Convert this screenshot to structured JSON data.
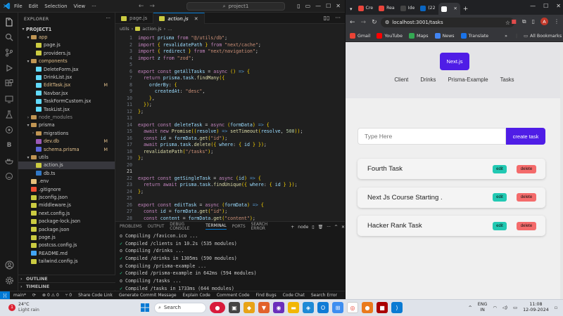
{
  "vscode": {
    "menu": [
      "File",
      "Edit",
      "Selection",
      "View"
    ],
    "search": "project1",
    "explorer_header": "EXPLORER",
    "tree": [
      {
        "label": "PROJECT1",
        "depth": 0,
        "arrow": "▾",
        "kind": "root",
        "status": "",
        "color": "#cccccc"
      },
      {
        "label": "app",
        "depth": 1,
        "arrow": "▾",
        "kind": "folder",
        "status": "",
        "color": "#e2c08d"
      },
      {
        "label": "page.js",
        "depth": 2,
        "arrow": "",
        "kind": "js",
        "status": "",
        "color": "#cccccc"
      },
      {
        "label": "providers.js",
        "depth": 2,
        "arrow": "",
        "kind": "js",
        "status": "",
        "color": "#cccccc"
      },
      {
        "label": "components",
        "depth": 1,
        "arrow": "▾",
        "kind": "folder",
        "status": "",
        "color": "#e2c08d"
      },
      {
        "label": "DeleteForm.jsx",
        "depth": 2,
        "arrow": "",
        "kind": "jsx",
        "status": "",
        "color": "#cccccc"
      },
      {
        "label": "DrinkList.jsx",
        "depth": 2,
        "arrow": "",
        "kind": "jsx",
        "status": "",
        "color": "#cccccc"
      },
      {
        "label": "EditTask.jsx",
        "depth": 2,
        "arrow": "",
        "kind": "jsx",
        "status": "M",
        "color": "#e2c08d"
      },
      {
        "label": "Navbar.jsx",
        "depth": 2,
        "arrow": "",
        "kind": "jsx",
        "status": "",
        "color": "#cccccc"
      },
      {
        "label": "TaskFormCustom.jsx",
        "depth": 2,
        "arrow": "",
        "kind": "jsx",
        "status": "",
        "color": "#cccccc"
      },
      {
        "label": "TaskList.jsx",
        "depth": 2,
        "arrow": "",
        "kind": "jsx",
        "status": "",
        "color": "#cccccc"
      },
      {
        "label": "node_modules",
        "depth": 1,
        "arrow": "›",
        "kind": "folder",
        "status": "",
        "color": "#8c8c8c"
      },
      {
        "label": "prisma",
        "depth": 1,
        "arrow": "▾",
        "kind": "folder",
        "status": "",
        "color": "#cccccc"
      },
      {
        "label": "migrations",
        "depth": 2,
        "arrow": "›",
        "kind": "folder",
        "status": "",
        "color": "#cccccc"
      },
      {
        "label": "dev.db",
        "depth": 2,
        "arrow": "",
        "kind": "db",
        "status": "M",
        "color": "#e2c08d"
      },
      {
        "label": "schema.prisma",
        "depth": 2,
        "arrow": "",
        "kind": "prisma",
        "status": "M",
        "color": "#e2c08d"
      },
      {
        "label": "utils",
        "depth": 1,
        "arrow": "▾",
        "kind": "folder",
        "status": "",
        "color": "#cccccc"
      },
      {
        "label": "action.js",
        "depth": 2,
        "arrow": "",
        "kind": "js",
        "status": "",
        "color": "#cccccc",
        "selected": true
      },
      {
        "label": "db.ts",
        "depth": 2,
        "arrow": "",
        "kind": "ts",
        "status": "",
        "color": "#cccccc"
      },
      {
        "label": ".env",
        "depth": 1,
        "arrow": "",
        "kind": "env",
        "status": "",
        "color": "#cccccc"
      },
      {
        "label": ".gitignore",
        "depth": 1,
        "arrow": "",
        "kind": "git",
        "status": "",
        "color": "#cccccc"
      },
      {
        "label": "jsconfig.json",
        "depth": 1,
        "arrow": "",
        "kind": "json",
        "status": "",
        "color": "#cccccc"
      },
      {
        "label": "middleware.js",
        "depth": 1,
        "arrow": "",
        "kind": "js",
        "status": "",
        "color": "#cccccc"
      },
      {
        "label": "next.config.js",
        "depth": 1,
        "arrow": "",
        "kind": "js",
        "status": "",
        "color": "#cccccc"
      },
      {
        "label": "package-lock.json",
        "depth": 1,
        "arrow": "",
        "kind": "json",
        "status": "",
        "color": "#cccccc"
      },
      {
        "label": "package.json",
        "depth": 1,
        "arrow": "",
        "kind": "json",
        "status": "",
        "color": "#cccccc"
      },
      {
        "label": "page.js",
        "depth": 1,
        "arrow": "",
        "kind": "js",
        "status": "",
        "color": "#cccccc"
      },
      {
        "label": "postcss.config.js",
        "depth": 1,
        "arrow": "",
        "kind": "js",
        "status": "",
        "color": "#cccccc"
      },
      {
        "label": "README.md",
        "depth": 1,
        "arrow": "",
        "kind": "md",
        "status": "",
        "color": "#cccccc"
      },
      {
        "label": "tailwind.config.js",
        "depth": 1,
        "arrow": "",
        "kind": "js",
        "status": "",
        "color": "#cccccc"
      }
    ],
    "outline": "OUTLINE",
    "timeline": "TIMELINE",
    "tabs": [
      {
        "label": "page.js",
        "active": false
      },
      {
        "label": "action.js",
        "active": true
      }
    ],
    "breadcrumb": [
      "utils",
      "›",
      "action.js",
      "›",
      "..."
    ],
    "current_line": 21,
    "code_lines": [
      "import prisma from \"@/utils/db\";",
      "import { revalidatePath } from \"next/cache\";",
      "import { redirect } from \"next/navigation\";",
      "import z from \"zod\";",
      "",
      "export const getAllTasks = async () => {",
      "  return prisma.task.findMany({",
      "    orderBy: {",
      "      createdAt: \"desc\",",
      "    },",
      "  });",
      "};",
      "",
      "export const deleteTask = async (formData) => {",
      "  await new Promise((resolve) => setTimeout(resolve, 500));",
      "  const id = formData.get(\"id\");",
      "  await prisma.task.delete({ where: { id } });",
      "  revalidatePath(\"/tasks\");",
      "};",
      "",
      "",
      "export const getSingleTask = async (id) => {",
      "  return await prisma.task.findUnique({ where: { id } });",
      "};",
      "",
      "export const editTask = async (formData) => {",
      "  const id = formData.get(\"id\");",
      "  const content = formData.get(\"content\");"
    ],
    "panel_tabs": [
      "PROBLEMS",
      "OUTPUT",
      "DEBUG CONSOLE",
      "TERMINAL",
      "PORTS",
      "SEARCH ERROR"
    ],
    "panel_active": "TERMINAL",
    "terminal_shell": "node",
    "terminal_lines": [
      {
        "mark": "o",
        "text": "Compiling /favicon.ico ..."
      },
      {
        "mark": "✓",
        "text": "Compiled /clients in 10.2s (535 modules)"
      },
      {
        "mark": "o",
        "text": "Compiling /drinks ..."
      },
      {
        "mark": "✓",
        "text": "Compiled /drinks in 1305ms (590 modules)"
      },
      {
        "mark": "o",
        "text": "Compiling /prisma-example ..."
      },
      {
        "mark": "✓",
        "text": "Compiled /prisma-example in 642ms (594 modules)"
      },
      {
        "mark": "o",
        "text": "Compiling /tasks ..."
      },
      {
        "mark": "✓",
        "text": "Compiled /tasks in 1733ms (644 modules)"
      },
      {
        "mark": "",
        "text": "▯"
      }
    ],
    "status_items": [
      "main*",
      "⟳",
      "⊗ 0 ⚠ 0",
      "⑂ 0",
      "Share Code Link",
      "Generate Commit Message",
      "Explain Code",
      "Comment Code",
      "Find Bugs",
      "Code Chat",
      "Search Error"
    ]
  },
  "chrome": {
    "tabs": [
      {
        "label": "Cre",
        "color": "#e8453c"
      },
      {
        "label": "Rea",
        "color": "#e8453c"
      },
      {
        "label": "Ide",
        "color": "#444444"
      },
      {
        "label": "(22",
        "color": "#0a66c2"
      },
      {
        "label": "",
        "color": "#ffffff",
        "active": true
      }
    ],
    "url": "localhost:3001/tasks",
    "bookmarks": [
      "Gmail",
      "YouTube",
      "Maps",
      "News",
      "Translate"
    ],
    "all_bookmarks": "All Bookmarks",
    "avatar": "A"
  },
  "app": {
    "brand": "Next.js",
    "nav": [
      "Client",
      "Drinks",
      "Prisma-Example",
      "Tasks"
    ],
    "input_placeholder": "Type Here",
    "create_label": "create task",
    "tasks": [
      {
        "title": "Fourth Task",
        "edit": "edit",
        "delete": "delete"
      },
      {
        "title": "Next Js Course Starting .",
        "edit": "edit",
        "delete": "delete"
      },
      {
        "title": "Hacker Rank Task",
        "edit": "edit",
        "delete": "delete"
      }
    ],
    "accent": "#4f1de6"
  },
  "taskbar": {
    "weather_temp": "24°C",
    "weather_text": "Light rain",
    "weather_badge": "1",
    "search": "Search",
    "lang1": "ENG",
    "lang2": "IN",
    "time": "11:08",
    "date": "12-09-2024"
  }
}
